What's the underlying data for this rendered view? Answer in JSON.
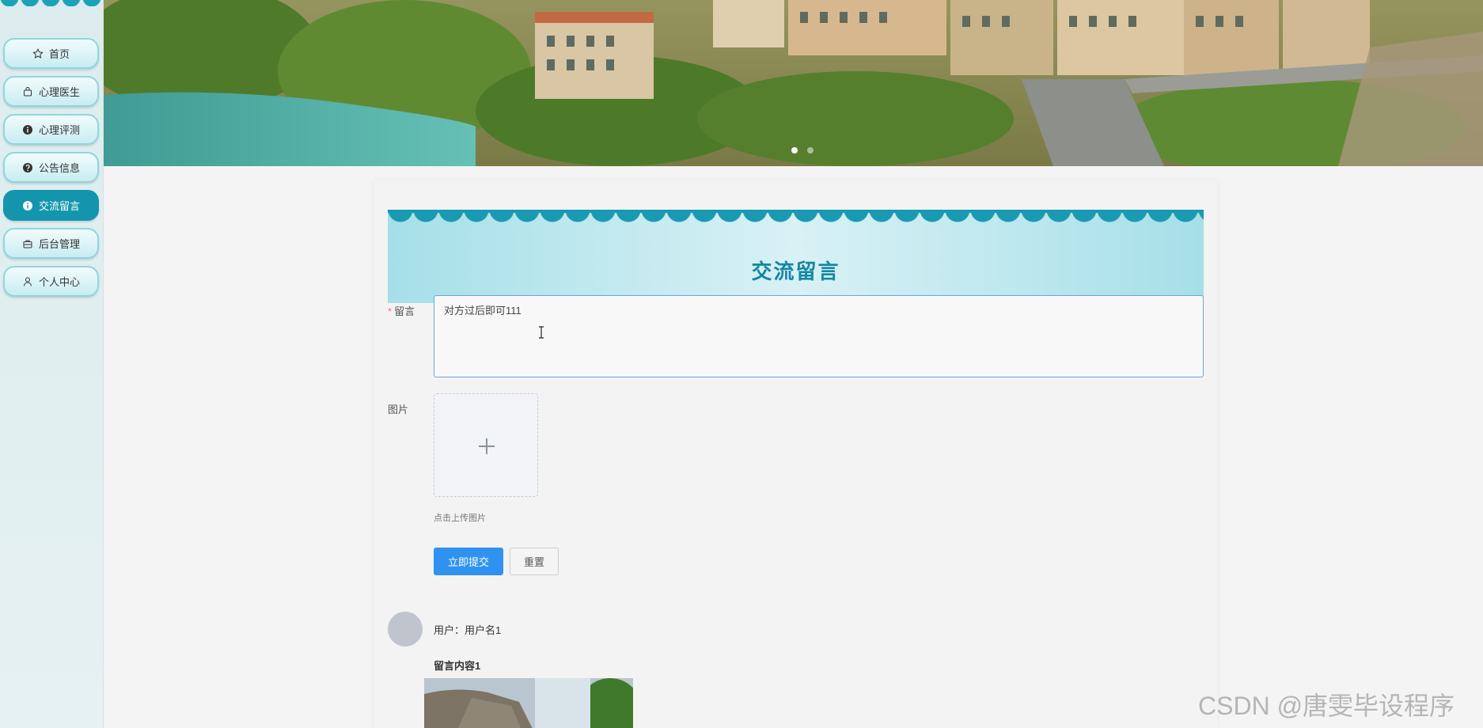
{
  "sidebar": {
    "items": [
      {
        "label": "首页",
        "icon": "star-icon"
      },
      {
        "label": "心理医生",
        "icon": "bag-icon"
      },
      {
        "label": "心理评测",
        "icon": "info-circle-icon"
      },
      {
        "label": "公告信息",
        "icon": "question-circle-icon"
      },
      {
        "label": "交流留言",
        "icon": "info-circle-icon",
        "active": true
      },
      {
        "label": "后台管理",
        "icon": "briefcase-icon"
      },
      {
        "label": "个人中心",
        "icon": "user-icon"
      }
    ],
    "active_color": "#1395ae"
  },
  "page": {
    "title": "交流留言"
  },
  "form": {
    "message_label": "留言",
    "required_mark": "*",
    "message_value": "对方过后即可111",
    "image_label": "图片",
    "upload_hint": "点击上传图片",
    "submit_label": "立即提交",
    "reset_label": "重置"
  },
  "comments": [
    {
      "user": "用户：用户名1",
      "content": "留言内容1"
    }
  ],
  "watermark": "CSDN @唐雯毕设程序"
}
